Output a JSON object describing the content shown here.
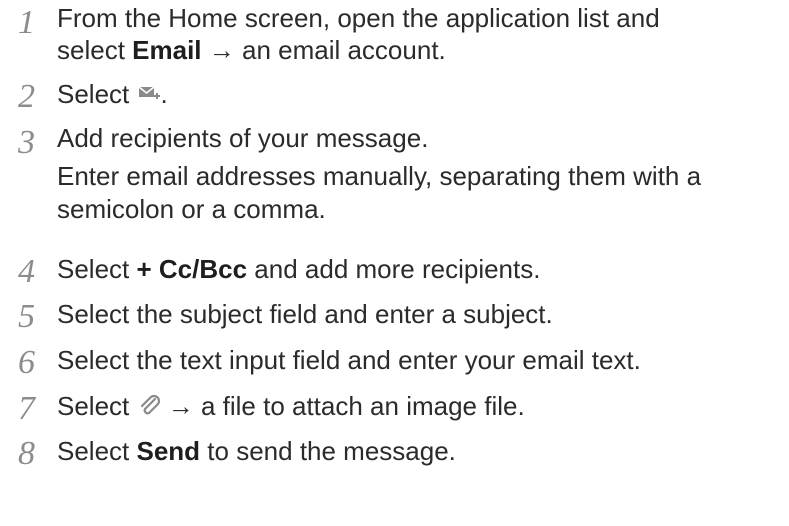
{
  "steps": [
    {
      "number": "1",
      "line1": "From the Home screen, open the application list and",
      "line2_pre": "select ",
      "line2_bold": "Email",
      "line2_post": " → an email account."
    },
    {
      "number": "2",
      "pre": "Select ",
      "icon": "compose-email-icon",
      "post": "."
    },
    {
      "number": "3",
      "line1": "Add recipients of your message.",
      "line2": "Enter email addresses manually, separating them with a",
      "line3": "semicolon or a comma."
    },
    {
      "number": "4",
      "pre": "Select ",
      "bold": "+ Cc/Bcc",
      "post": " and add more recipients."
    },
    {
      "number": "5",
      "text": "Select the subject field and enter a subject."
    },
    {
      "number": "6",
      "text": "Select the text input field and enter your email text."
    },
    {
      "number": "7",
      "pre": "Select ",
      "icon": "paperclip-icon",
      "post": " → a file to attach an image file."
    },
    {
      "number": "8",
      "pre": "Select ",
      "bold": "Send",
      "post": " to send the message."
    }
  ]
}
